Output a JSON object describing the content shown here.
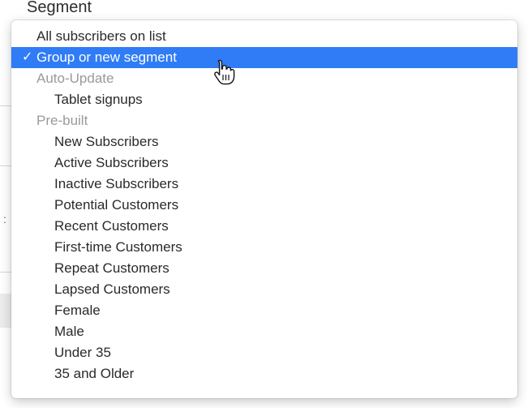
{
  "field_label": "Segment",
  "menu": {
    "check_glyph": "✓",
    "top_item": "All subscribers on list",
    "selected_item": "Group or new segment",
    "groups": [
      {
        "header": "Auto-Update",
        "items": [
          "Tablet signups"
        ]
      },
      {
        "header": "Pre-built",
        "items": [
          "New Subscribers",
          "Active Subscribers",
          "Inactive Subscribers",
          "Potential Customers",
          "Recent Customers",
          "First-time Customers",
          "Repeat Customers",
          "Lapsed Customers",
          "Female",
          "Male",
          "Under 35",
          "35 and Older"
        ]
      }
    ]
  },
  "colors": {
    "selection": "#2f7cf6",
    "header_text": "#9a9a9a"
  },
  "icons": {
    "pointer": "hand-pointer-icon",
    "check": "checkmark-icon"
  }
}
